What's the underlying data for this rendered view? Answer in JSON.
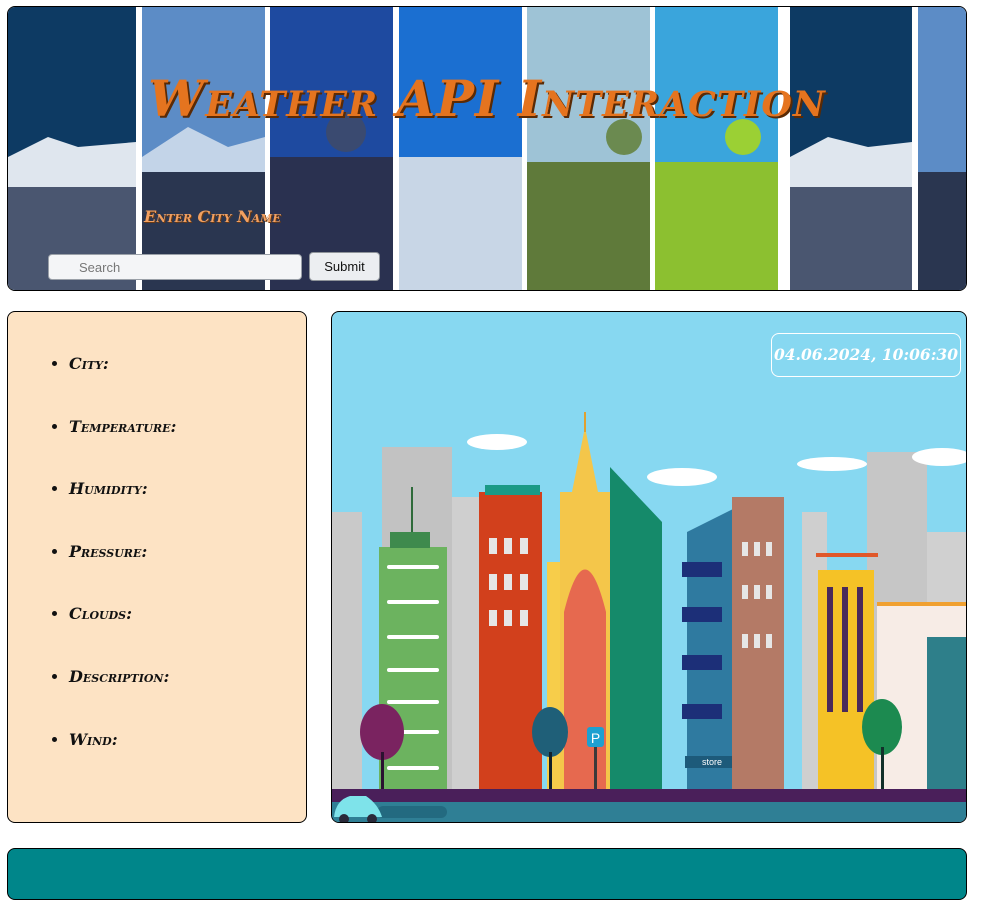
{
  "header": {
    "title": "Weather API Interaction",
    "city_label": "Enter City Name",
    "search": {
      "placeholder": "Search",
      "value": ""
    },
    "submit_label": "Submit",
    "icons": [
      "search-icon"
    ]
  },
  "weather_info": {
    "items": [
      {
        "label": "City:"
      },
      {
        "label": "Temperature:"
      },
      {
        "label": "Humidity:"
      },
      {
        "label": "Pressure:"
      },
      {
        "label": "Clouds:"
      },
      {
        "label": "Description:"
      },
      {
        "label": "Wind:"
      }
    ]
  },
  "scene": {
    "datetime": "04.06.2024, 10:06:30",
    "store_sign": "store",
    "parking_sign": "P"
  },
  "colors": {
    "title": "#e5741f",
    "info_panel_bg": "#fde3c4",
    "sky": "#87d8f1",
    "footer_bg": "#00868a"
  }
}
